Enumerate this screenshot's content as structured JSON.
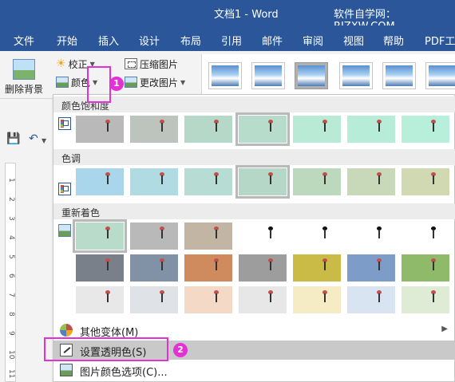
{
  "titlebar": {
    "title": "文档1  -  Word",
    "site": "软件自学网：RJZXW.COM",
    "bg_color": "#2b579a"
  },
  "tabs": [
    "文件",
    "开始",
    "插入",
    "设计",
    "布局",
    "引用",
    "邮件",
    "审阅",
    "视图",
    "帮助",
    "PDF工具"
  ],
  "ribbon": {
    "remove_bg": "删除背景",
    "corrections": "校正",
    "color": "颜色",
    "compress": "压缩图片",
    "change": "更改图片"
  },
  "ruler_numbers": [
    "1",
    "2",
    "3",
    "4",
    "5",
    "6",
    "7",
    "8",
    "9",
    "10",
    "11"
  ],
  "menu": {
    "sections": [
      {
        "title": "颜色饱和度",
        "rows": [
          [
            "#b9b9b9",
            "#bcc4bd",
            "#b6d8c8",
            "#b7dccb",
            "#b8ead6",
            "#b7ecd8",
            "#b8efda"
          ]
        ]
      },
      {
        "title": "色调",
        "rows": [
          [
            "#a9d6ea",
            "#b1dbe3",
            "#b6dcd3",
            "#b5d7c7",
            "#bcd8bd",
            "#c7d9b8",
            "#d1d9b3"
          ]
        ]
      },
      {
        "title": "重新着色",
        "rows": [
          [
            "#b8dcc9",
            "#b9b9b9",
            "#c3b5a3",
            "#ffffff",
            "#ffffff",
            "#ffffff",
            "#ffffff"
          ],
          [
            "#7a808a",
            "#8192a6",
            "#cf8a5e",
            "#9d9d9d",
            "#c9bb45",
            "#7d9dc8",
            "#8fba6a"
          ],
          [
            "#e8e8e8",
            "#dfe3e8",
            "#f4d9c6",
            "#e7e7e7",
            "#f5ecc6",
            "#d9e4f2",
            "#dfecd5"
          ]
        ]
      }
    ],
    "selected_saturation": 3,
    "selected_tone": 3,
    "selected_recolor": 0,
    "items": [
      {
        "label": "其他变体(M)",
        "icon": "color-wheel-icon"
      },
      {
        "label": "设置透明色(S)",
        "icon": "set-transparent-color-icon"
      },
      {
        "label": "图片颜色选项(C)...",
        "icon": "picture-color-options-icon"
      }
    ]
  },
  "annotations": {
    "badge1": "1",
    "badge2": "2",
    "accent": "#e431d6"
  }
}
